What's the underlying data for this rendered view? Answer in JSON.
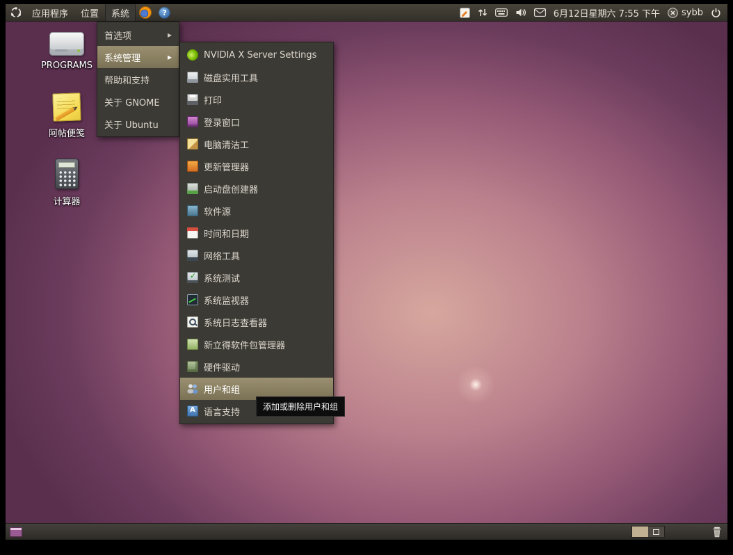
{
  "colors": {
    "panel_bg": "#3a3732",
    "menu_bg": "#3c3a35",
    "menu_highlight": "#8a8164",
    "tooltip_bg": "#0d0d0d",
    "wallpaper_base": "#532c4b",
    "wallpaper_glow": "#d7a79e",
    "workspace_active": "#c2b092"
  },
  "top_panel": {
    "menus": [
      {
        "label": "应用程序"
      },
      {
        "label": "位置"
      },
      {
        "label": "系统"
      }
    ],
    "launchers": [
      {
        "icon": "firefox-icon"
      },
      {
        "icon": "help-icon"
      }
    ],
    "indicators": [
      {
        "icon": "notes-indicator-icon"
      },
      {
        "icon": "network-arrows-icon"
      },
      {
        "icon": "keyboard-indicator-icon"
      },
      {
        "icon": "volume-icon"
      },
      {
        "icon": "mail-indicator-icon"
      }
    ],
    "clock": "6月12日星期六 7:55 下午",
    "username": "sybb"
  },
  "system_menu": {
    "items": [
      {
        "label": "首选项",
        "has_submenu": true
      },
      {
        "label": "系统管理",
        "has_submenu": true,
        "highlighted": true
      },
      {
        "label": "帮助和支持"
      },
      {
        "label": "关于 GNOME"
      },
      {
        "label": "关于 Ubuntu"
      }
    ]
  },
  "admin_submenu": {
    "items": [
      {
        "label": "NVIDIA X Server Settings",
        "icon": "nvidia-icon"
      },
      {
        "label": "磁盘实用工具",
        "icon": "disk-utility-icon"
      },
      {
        "label": "打印",
        "icon": "printer-icon"
      },
      {
        "label": "登录窗口",
        "icon": "login-window-icon"
      },
      {
        "label": "电脑清洁工",
        "icon": "computer-janitor-icon"
      },
      {
        "label": "更新管理器",
        "icon": "update-manager-icon"
      },
      {
        "label": "启动盘创建器",
        "icon": "startup-disk-creator-icon"
      },
      {
        "label": "软件源",
        "icon": "software-sources-icon"
      },
      {
        "label": "时间和日期",
        "icon": "time-date-icon"
      },
      {
        "label": "网络工具",
        "icon": "network-tools-icon"
      },
      {
        "label": "系统测试",
        "icon": "system-testing-icon"
      },
      {
        "label": "系统监视器",
        "icon": "system-monitor-icon"
      },
      {
        "label": "系统日志查看器",
        "icon": "log-viewer-icon"
      },
      {
        "label": "新立得软件包管理器",
        "icon": "synaptic-icon"
      },
      {
        "label": "硬件驱动",
        "icon": "hardware-drivers-icon"
      },
      {
        "label": "用户和组",
        "icon": "users-groups-icon",
        "highlighted": true
      },
      {
        "label": "语言支持",
        "icon": "language-support-icon"
      }
    ]
  },
  "tooltip": {
    "text": "添加或删除用户和组"
  },
  "desktop": {
    "icons": [
      {
        "label": "PROGRAMS",
        "icon": "drive-icon"
      },
      {
        "label": "阿帖便笺",
        "icon": "sticky-note-icon"
      },
      {
        "label": "计算器",
        "icon": "calculator-icon"
      }
    ]
  },
  "bottom_panel": {
    "workspaces": {
      "count": 2,
      "active": 1
    }
  }
}
